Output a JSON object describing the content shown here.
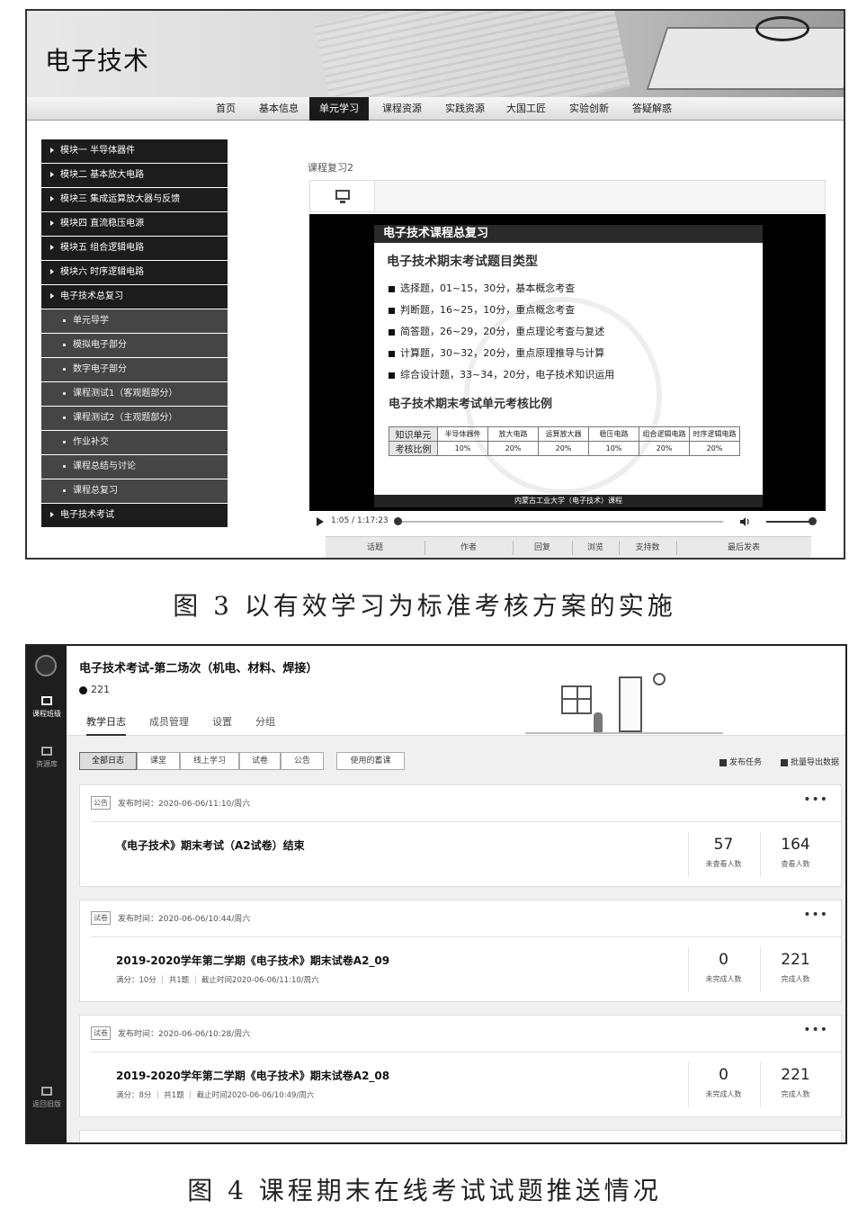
{
  "figure3": {
    "site_title": "电子技术",
    "nav": [
      "首页",
      "基本信息",
      "单元学习",
      "课程资源",
      "实践资源",
      "大国工匠",
      "实验创新",
      "答疑解惑"
    ],
    "nav_active": 2,
    "sidebar": {
      "modules": [
        "模块一 半导体器件",
        "模块二 基本放大电路",
        "模块三 集成运算放大器与反馈",
        "模块四 直流稳压电源",
        "模块五 组合逻辑电路",
        "模块六 时序逻辑电路",
        "电子技术总复习"
      ],
      "subitems": [
        "单元导学",
        "模拟电子部分",
        "数字电子部分",
        "课程测试1（客观题部分）",
        "课程测试2（主观题部分）",
        "作业补交",
        "课程总结与讨论",
        "课程总复习"
      ],
      "last_module": "电子技术考试"
    },
    "breadcrumb": "课程复习2",
    "slide": {
      "title": "电子技术课程总复习",
      "heading1": "电子技术期末考试题目类型",
      "bullets": [
        "选择题，01~15，30分，基本概念考查",
        "判断题，16~25，10分，重点概念考查",
        "简答题，26~29，20分，重点理论考查与复述",
        "计算题，30~32，20分，重点原理推导与计算",
        "综合设计题，33~34，20分，电子技术知识运用"
      ],
      "heading2": "电子技术期末考试单元考核比例",
      "table": {
        "row1_label": "知识单元",
        "row2_label": "考核比例",
        "units": [
          "半导体器件",
          "放大电路",
          "运算放大器",
          "稳压电路",
          "组合逻辑电路",
          "时序逻辑电路"
        ],
        "ratios": [
          "10%",
          "20%",
          "20%",
          "10%",
          "20%",
          "20%"
        ]
      },
      "footer": "内蒙古工业大学（电子技术）课程"
    },
    "player": {
      "time": "1:05 / 1:17:23",
      "progress": 0.012,
      "volume": 1.0
    },
    "forum_columns": [
      "话题",
      "作者",
      "回复",
      "浏览",
      "支持数",
      "最后发表"
    ]
  },
  "caption3": "图 3   以有效学习为标准考核方案的实施",
  "figure4": {
    "rail": {
      "item1": "课程班级",
      "item2": "资源库",
      "item3": "返回旧版"
    },
    "title": "电子技术考试-第二场次（机电、材料、焊接）",
    "member_count": "221",
    "tabs": [
      "教学日志",
      "成员管理",
      "设置",
      "分组"
    ],
    "filters": [
      "全部日志",
      "课堂",
      "线上学习",
      "试卷",
      "公告"
    ],
    "used_filter": "使用的蓄课",
    "actions": {
      "publish": "发布任务",
      "export": "批量导出数据"
    },
    "cards": [
      {
        "tag": "公告",
        "pub": "发布时间：2020-06-06/11:10/周六",
        "title": "《电子技术》期末考试（A2试卷）结束",
        "meta": "",
        "stat1_num": "57",
        "stat1_label": "未查看人数",
        "stat2_num": "164",
        "stat2_label": "查看人数"
      },
      {
        "tag": "试卷",
        "pub": "发布时间：2020-06-06/10:44/周六",
        "title": "2019-2020学年第二学期《电子技术》期末试卷A2_09",
        "meta": "满分：10分  ｜ 共1题  ｜ 截止时间2020-06-06/11:10/周六",
        "stat1_num": "0",
        "stat1_label": "未完成人数",
        "stat2_num": "221",
        "stat2_label": "完成人数"
      },
      {
        "tag": "试卷",
        "pub": "发布时间：2020-06-06/10:28/周六",
        "title": "2019-2020学年第二学期《电子技术》期末试卷A2_08",
        "meta": "满分：8分  ｜ 共1题  ｜ 截止时间2020-06-06/10:49/周六",
        "stat1_num": "0",
        "stat1_label": "未完成人数",
        "stat2_num": "221",
        "stat2_label": "完成人数"
      }
    ],
    "more_label": "•••"
  },
  "caption4": "图 4   课程期末在线考试试题推送情况"
}
